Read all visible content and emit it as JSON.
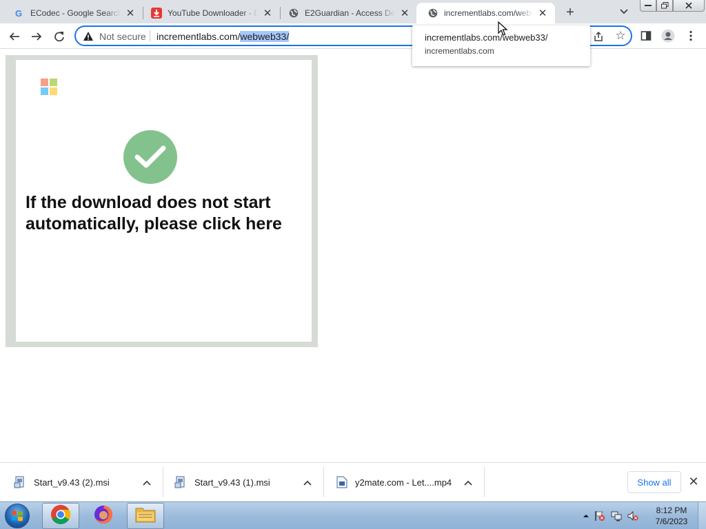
{
  "browser": {
    "tabs": [
      {
        "title": "ECodec - Google Search",
        "favicon": "google-icon"
      },
      {
        "title": "YouTube Downloader - Do",
        "favicon": "download-arrow-icon"
      },
      {
        "title": "E2Guardian - Access Den",
        "favicon": "globe-icon"
      },
      {
        "title": "incrementlabs.com/webw",
        "favicon": "globe-icon",
        "active": true
      }
    ],
    "omnibox": {
      "security_label": "Not secure",
      "url_prefix": "incrementlabs.com/",
      "url_selected": "webweb33/"
    },
    "hover_card": {
      "title": "incrementlabs.com/webweb33/",
      "domain": "incrementlabs.com"
    }
  },
  "page": {
    "message": "If the download does not start automatically, please click here",
    "logo_colors": [
      "#f25022",
      "#7fba00",
      "#00a4ef",
      "#ffb900"
    ],
    "check_color": "#84c28d"
  },
  "downloads": {
    "items": [
      {
        "name": "Start_v9.43 (2).msi",
        "icon": "msi-file-icon"
      },
      {
        "name": "Start_v9.43 (1).msi",
        "icon": "msi-file-icon"
      },
      {
        "name": "y2mate.com - Let....mp4",
        "icon": "video-file-icon"
      }
    ],
    "show_all_label": "Show all"
  },
  "taskbar": {
    "pinned": [
      "chrome-icon",
      "firefox-icon",
      "file-explorer-icon"
    ],
    "clock_time": "8:12 PM",
    "clock_date": "7/6/2023"
  }
}
